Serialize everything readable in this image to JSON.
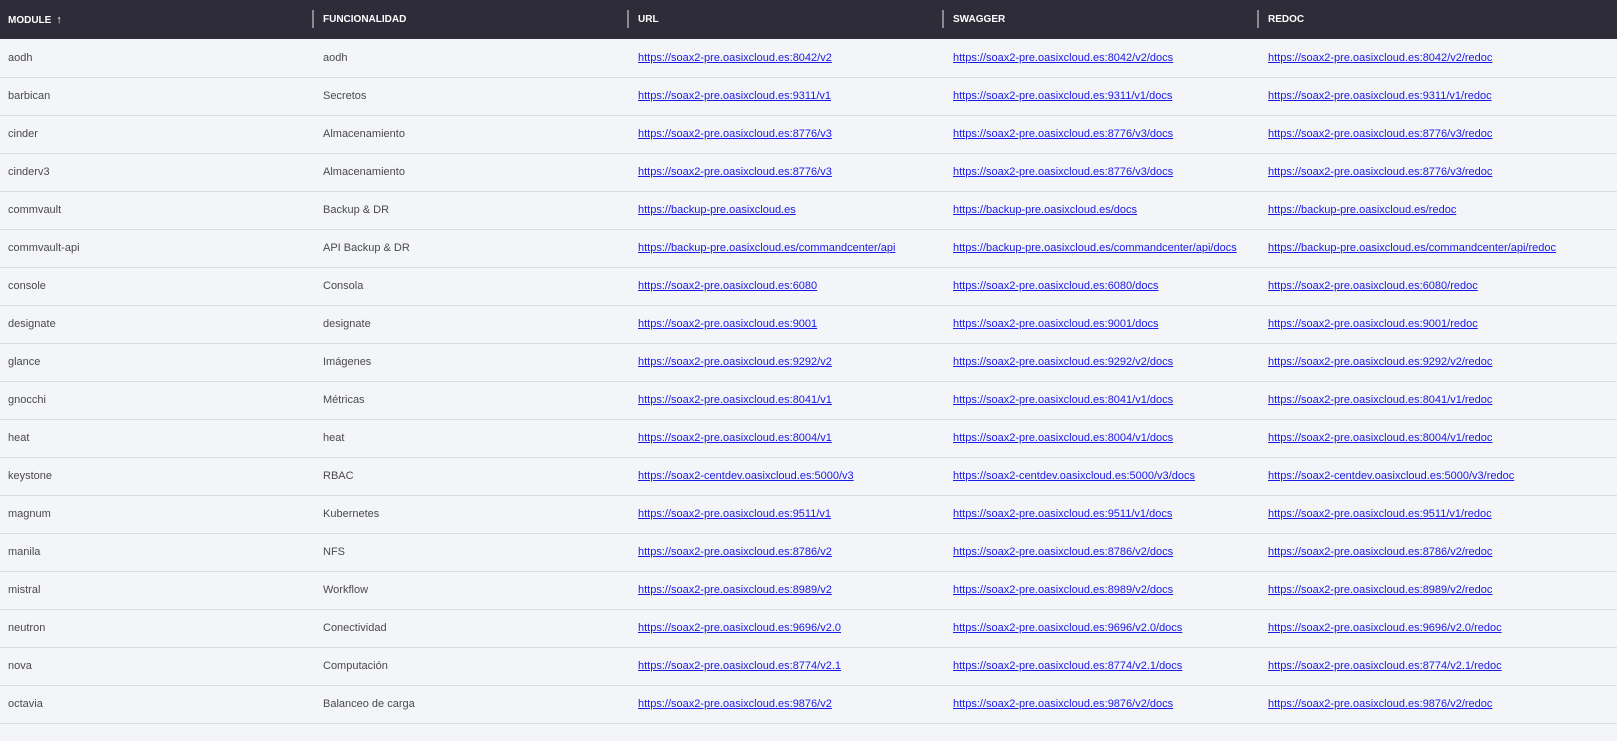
{
  "headers": {
    "module": "MODULE",
    "funcionalidad": "FUNCIONALIDAD",
    "url": "URL",
    "swagger": "SWAGGER",
    "redoc": "REDOC",
    "sort_icon": "arrow-up-icon"
  },
  "colors": {
    "header_bg": "#2e2c38",
    "row_bg": "#f4f5f9",
    "link": "#1a1ae6"
  },
  "rows": [
    {
      "module": "aodh",
      "func": "aodh",
      "url": "https://soax2-pre.oasixcloud.es:8042/v2",
      "swagger": "https://soax2-pre.oasixcloud.es:8042/v2/docs",
      "redoc": "https://soax2-pre.oasixcloud.es:8042/v2/redoc"
    },
    {
      "module": "barbican",
      "func": "Secretos",
      "url": "https://soax2-pre.oasixcloud.es:9311/v1",
      "swagger": "https://soax2-pre.oasixcloud.es:9311/v1/docs",
      "redoc": "https://soax2-pre.oasixcloud.es:9311/v1/redoc"
    },
    {
      "module": "cinder",
      "func": "Almacenamiento",
      "url": "https://soax2-pre.oasixcloud.es:8776/v3",
      "swagger": "https://soax2-pre.oasixcloud.es:8776/v3/docs",
      "redoc": "https://soax2-pre.oasixcloud.es:8776/v3/redoc"
    },
    {
      "module": "cinderv3",
      "func": "Almacenamiento",
      "url": "https://soax2-pre.oasixcloud.es:8776/v3",
      "swagger": "https://soax2-pre.oasixcloud.es:8776/v3/docs",
      "redoc": "https://soax2-pre.oasixcloud.es:8776/v3/redoc"
    },
    {
      "module": "commvault",
      "func": "Backup & DR",
      "url": "https://backup-pre.oasixcloud.es",
      "swagger": "https://backup-pre.oasixcloud.es/docs",
      "redoc": "https://backup-pre.oasixcloud.es/redoc"
    },
    {
      "module": "commvault-api",
      "func": "API Backup & DR",
      "url": "https://backup-pre.oasixcloud.es/commandcenter/api",
      "swagger": "https://backup-pre.oasixcloud.es/commandcenter/api/docs",
      "redoc": "https://backup-pre.oasixcloud.es/commandcenter/api/redoc"
    },
    {
      "module": "console",
      "func": "Consola",
      "url": "https://soax2-pre.oasixcloud.es:6080",
      "swagger": "https://soax2-pre.oasixcloud.es:6080/docs",
      "redoc": "https://soax2-pre.oasixcloud.es:6080/redoc"
    },
    {
      "module": "designate",
      "func": "designate",
      "url": "https://soax2-pre.oasixcloud.es:9001",
      "swagger": "https://soax2-pre.oasixcloud.es:9001/docs",
      "redoc": "https://soax2-pre.oasixcloud.es:9001/redoc"
    },
    {
      "module": "glance",
      "func": "Imágenes",
      "url": "https://soax2-pre.oasixcloud.es:9292/v2",
      "swagger": "https://soax2-pre.oasixcloud.es:9292/v2/docs",
      "redoc": "https://soax2-pre.oasixcloud.es:9292/v2/redoc"
    },
    {
      "module": "gnocchi",
      "func": "Métricas",
      "url": "https://soax2-pre.oasixcloud.es:8041/v1",
      "swagger": "https://soax2-pre.oasixcloud.es:8041/v1/docs",
      "redoc": "https://soax2-pre.oasixcloud.es:8041/v1/redoc"
    },
    {
      "module": "heat",
      "func": "heat",
      "url": "https://soax2-pre.oasixcloud.es:8004/v1",
      "swagger": "https://soax2-pre.oasixcloud.es:8004/v1/docs",
      "redoc": "https://soax2-pre.oasixcloud.es:8004/v1/redoc"
    },
    {
      "module": "keystone",
      "func": "RBAC",
      "url": "https://soax2-centdev.oasixcloud.es:5000/v3",
      "swagger": "https://soax2-centdev.oasixcloud.es:5000/v3/docs",
      "redoc": "https://soax2-centdev.oasixcloud.es:5000/v3/redoc"
    },
    {
      "module": "magnum",
      "func": "Kubernetes",
      "url": "https://soax2-pre.oasixcloud.es:9511/v1",
      "swagger": "https://soax2-pre.oasixcloud.es:9511/v1/docs",
      "redoc": "https://soax2-pre.oasixcloud.es:9511/v1/redoc"
    },
    {
      "module": "manila",
      "func": "NFS",
      "url": "https://soax2-pre.oasixcloud.es:8786/v2",
      "swagger": "https://soax2-pre.oasixcloud.es:8786/v2/docs",
      "redoc": "https://soax2-pre.oasixcloud.es:8786/v2/redoc"
    },
    {
      "module": "mistral",
      "func": "Workflow",
      "url": "https://soax2-pre.oasixcloud.es:8989/v2",
      "swagger": "https://soax2-pre.oasixcloud.es:8989/v2/docs",
      "redoc": "https://soax2-pre.oasixcloud.es:8989/v2/redoc"
    },
    {
      "module": "neutron",
      "func": "Conectividad",
      "url": "https://soax2-pre.oasixcloud.es:9696/v2.0",
      "swagger": "https://soax2-pre.oasixcloud.es:9696/v2.0/docs",
      "redoc": "https://soax2-pre.oasixcloud.es:9696/v2.0/redoc"
    },
    {
      "module": "nova",
      "func": "Computación",
      "url": "https://soax2-pre.oasixcloud.es:8774/v2.1",
      "swagger": "https://soax2-pre.oasixcloud.es:8774/v2.1/docs",
      "redoc": "https://soax2-pre.oasixcloud.es:8774/v2.1/redoc"
    },
    {
      "module": "octavia",
      "func": "Balanceo de carga",
      "url": "https://soax2-pre.oasixcloud.es:9876/v2",
      "swagger": "https://soax2-pre.oasixcloud.es:9876/v2/docs",
      "redoc": "https://soax2-pre.oasixcloud.es:9876/v2/redoc"
    }
  ]
}
